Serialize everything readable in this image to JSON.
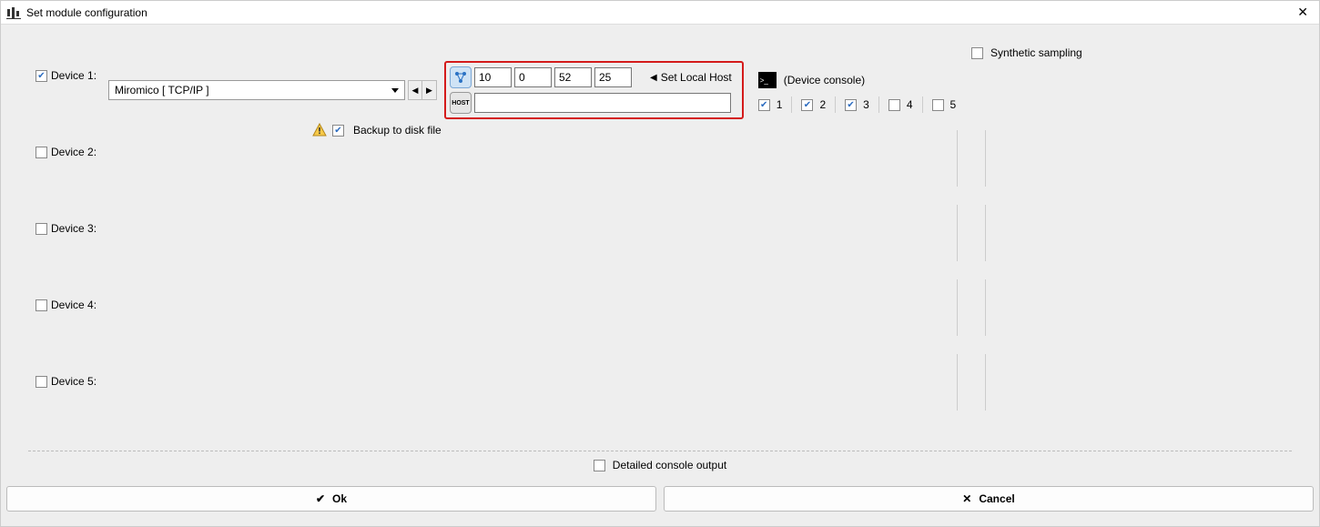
{
  "window": {
    "title": "Set module configuration"
  },
  "devices": [
    {
      "label": "Device 1:",
      "checked": true
    },
    {
      "label": "Device 2:",
      "checked": false
    },
    {
      "label": "Device 3:",
      "checked": false
    },
    {
      "label": "Device 4:",
      "checked": false
    },
    {
      "label": "Device 5:",
      "checked": false
    }
  ],
  "device1": {
    "dropdown": "Miromico [ TCP/IP ]",
    "backup_label": "Backup to disk file",
    "backup_checked": true,
    "ip": {
      "a": "10",
      "b": "0",
      "c": "52",
      "d": "25"
    },
    "set_localhost_label": "Set Local Host",
    "host_value": "",
    "console_label": "(Device console)",
    "nums": [
      {
        "label": "1",
        "checked": true
      },
      {
        "label": "2",
        "checked": true
      },
      {
        "label": "3",
        "checked": true
      },
      {
        "label": "4",
        "checked": false
      },
      {
        "label": "5",
        "checked": false
      }
    ]
  },
  "right": {
    "synthetic_label": "Synthetic sampling",
    "synthetic_checked": false
  },
  "bottom": {
    "detailed_label": "Detailed console output",
    "detailed_checked": false,
    "ok_label": "Ok",
    "cancel_label": "Cancel"
  }
}
